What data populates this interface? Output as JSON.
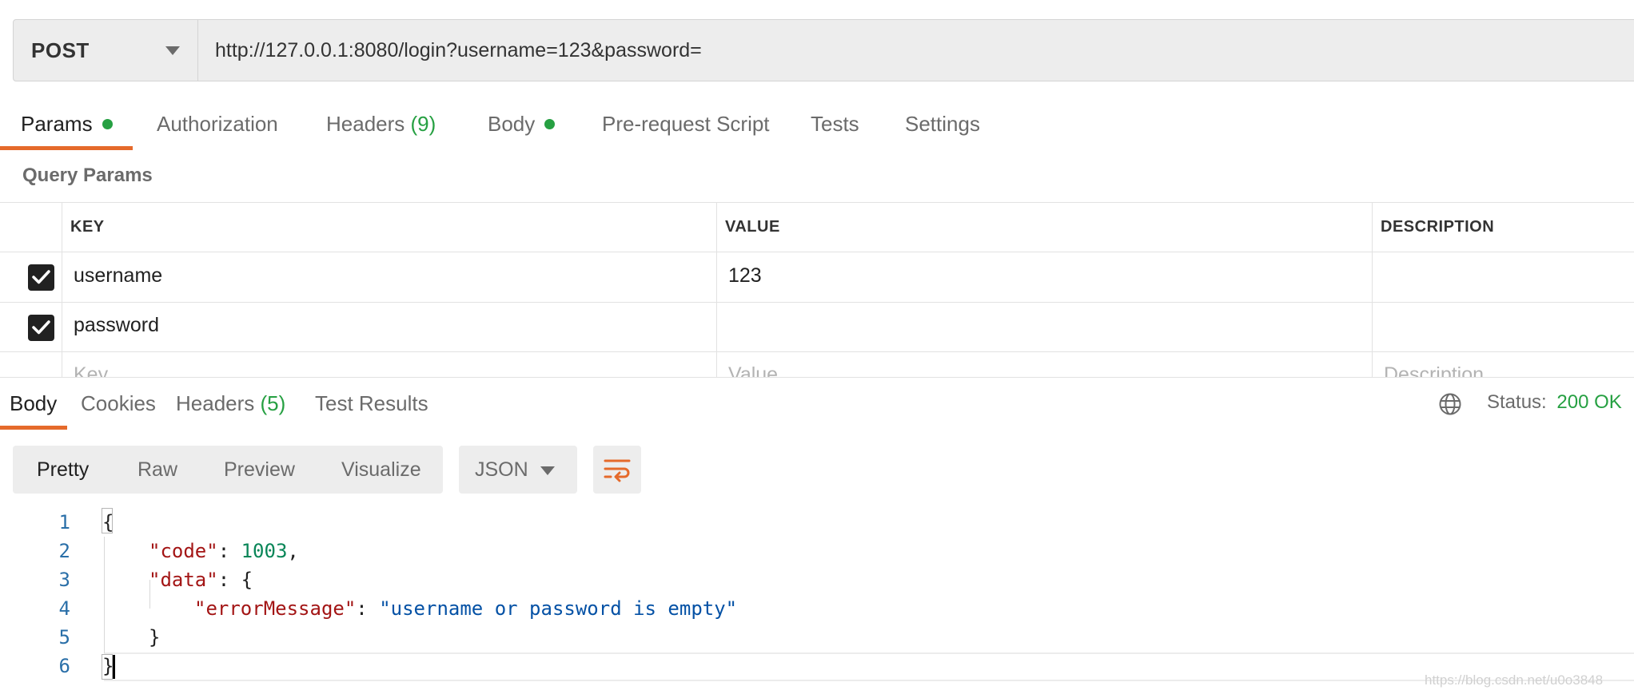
{
  "request": {
    "method": "POST",
    "url": "http://127.0.0.1:8080/login?username=123&password="
  },
  "request_tabs": {
    "params": "Params",
    "authorization": "Authorization",
    "headers": "Headers",
    "headers_count": "(9)",
    "body": "Body",
    "pre_request": "Pre-request Script",
    "tests": "Tests",
    "settings": "Settings"
  },
  "query_params": {
    "title": "Query Params",
    "columns": {
      "key": "KEY",
      "value": "VALUE",
      "description": "DESCRIPTION"
    },
    "rows": [
      {
        "key": "username",
        "value": "123",
        "checked": true
      },
      {
        "key": "password",
        "value": "",
        "checked": true
      }
    ],
    "placeholders": {
      "key": "Key",
      "value": "Value",
      "description": "Description"
    }
  },
  "response_tabs": {
    "body": "Body",
    "cookies": "Cookies",
    "headers": "Headers",
    "headers_count": "(5)",
    "test_results": "Test Results"
  },
  "status": {
    "label": "Status:",
    "value": "200 OK"
  },
  "view": {
    "pretty": "Pretty",
    "raw": "Raw",
    "preview": "Preview",
    "visualize": "Visualize",
    "format": "JSON"
  },
  "code": {
    "line_numbers": [
      "1",
      "2",
      "3",
      "4",
      "5",
      "6"
    ],
    "open_brace": "{",
    "code_key": "\"code\"",
    "code_value": "1003",
    "data_key": "\"data\"",
    "error_key": "\"errorMessage\"",
    "error_value": "\"username or password is empty\"",
    "close_inner": "}",
    "close_brace": "}"
  },
  "watermark": "https://blog.csdn.net/u0o3848",
  "colors": {
    "accent": "#e56a2b",
    "success": "#26a042"
  }
}
